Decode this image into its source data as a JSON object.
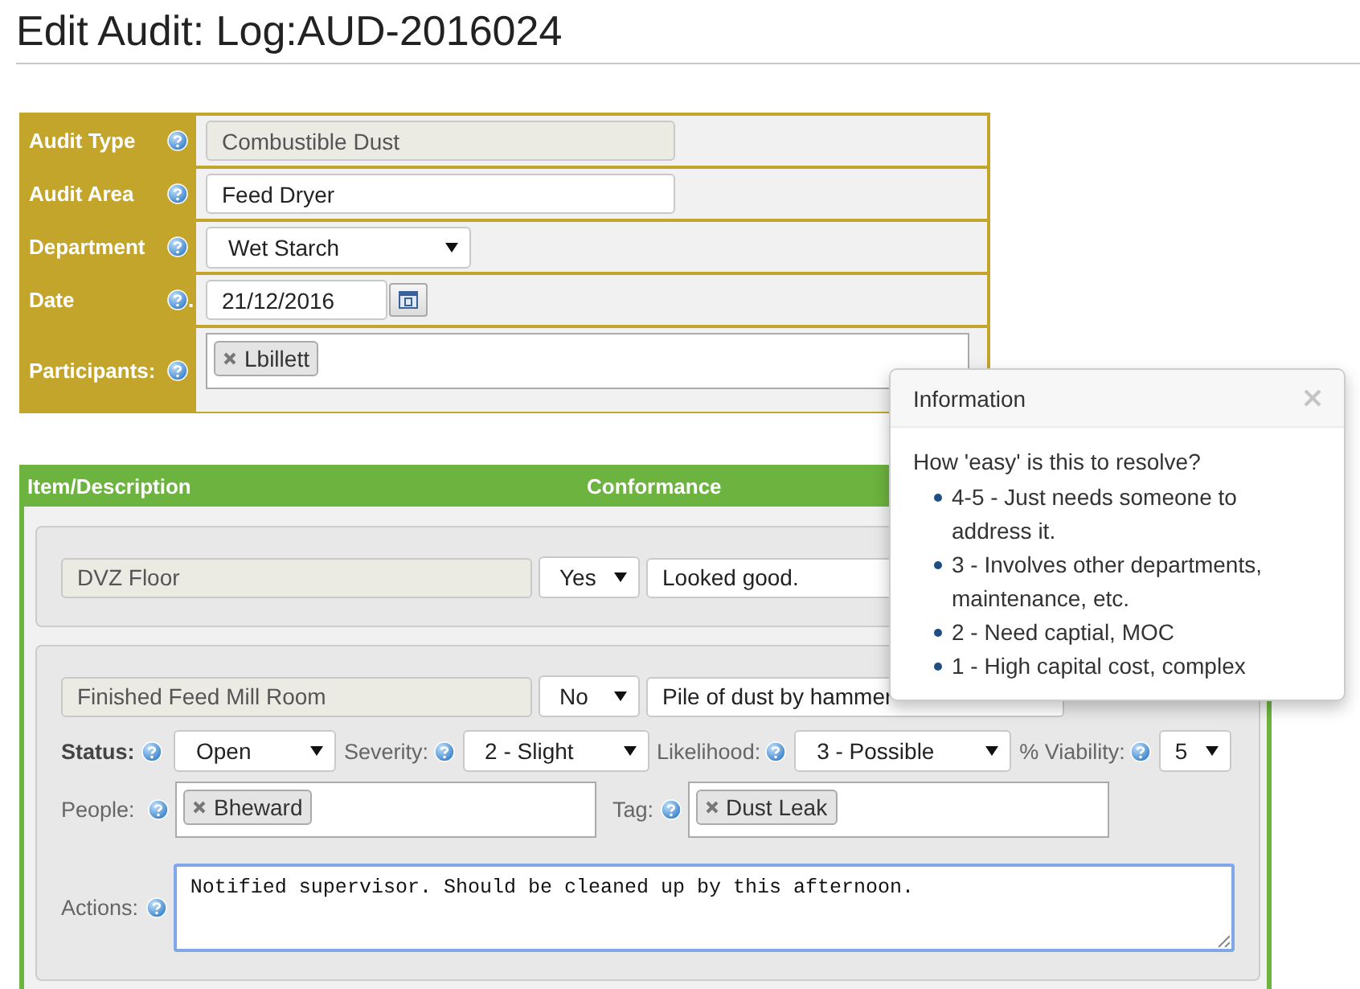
{
  "title": "Edit Audit: Log:AUD-2016024",
  "audit_fields": [
    {
      "kind": "readonly",
      "label": "Audit Type",
      "value": "Combustible Dust"
    },
    {
      "kind": "text",
      "label": "Audit Area",
      "value": "Feed Dryer"
    },
    {
      "kind": "select",
      "label": "Department",
      "value": "Wet Starch"
    },
    {
      "kind": "date",
      "label": "Date",
      "suffix": ".",
      "value": "21/12/2016"
    },
    {
      "kind": "tags",
      "label": "Participants:",
      "tags": [
        "Lbillett"
      ]
    }
  ],
  "items_table": {
    "columns": [
      "Item/Description",
      "Conformance"
    ],
    "items": [
      {
        "description": "DVZ Floor",
        "conformance": "Yes",
        "comment": "Looked good."
      },
      {
        "description": "Finished Feed Mill Room",
        "conformance": "No",
        "comment": "Pile of dust by hammer",
        "ratings": [
          {
            "label": "Status:",
            "bold": true,
            "value": "Open"
          },
          {
            "label": "Severity:",
            "bold": false,
            "value": "2 - Slight"
          },
          {
            "label": "Likelihood:",
            "bold": false,
            "value": "3 - Possible"
          },
          {
            "label": "% Viability:",
            "bold": false,
            "value": "5"
          }
        ],
        "tag_fields": [
          {
            "label": "People:",
            "tags": [
              "Bheward"
            ]
          },
          {
            "label": "Tag:",
            "tags": [
              "Dust Leak"
            ]
          }
        ],
        "actions": {
          "label": "Actions:",
          "value": "Notified supervisor. Should be cleaned up by this afternoon.",
          "focused": true
        }
      }
    ]
  },
  "popover": {
    "title": "Information",
    "intro": "How 'easy' is this to resolve?",
    "items": [
      "4-5 - Just needs someone to address it.",
      "3 - Involves other departments, maintenance, etc.",
      "2 - Need captial, MOC",
      "1 - High capital cost, complex"
    ]
  }
}
